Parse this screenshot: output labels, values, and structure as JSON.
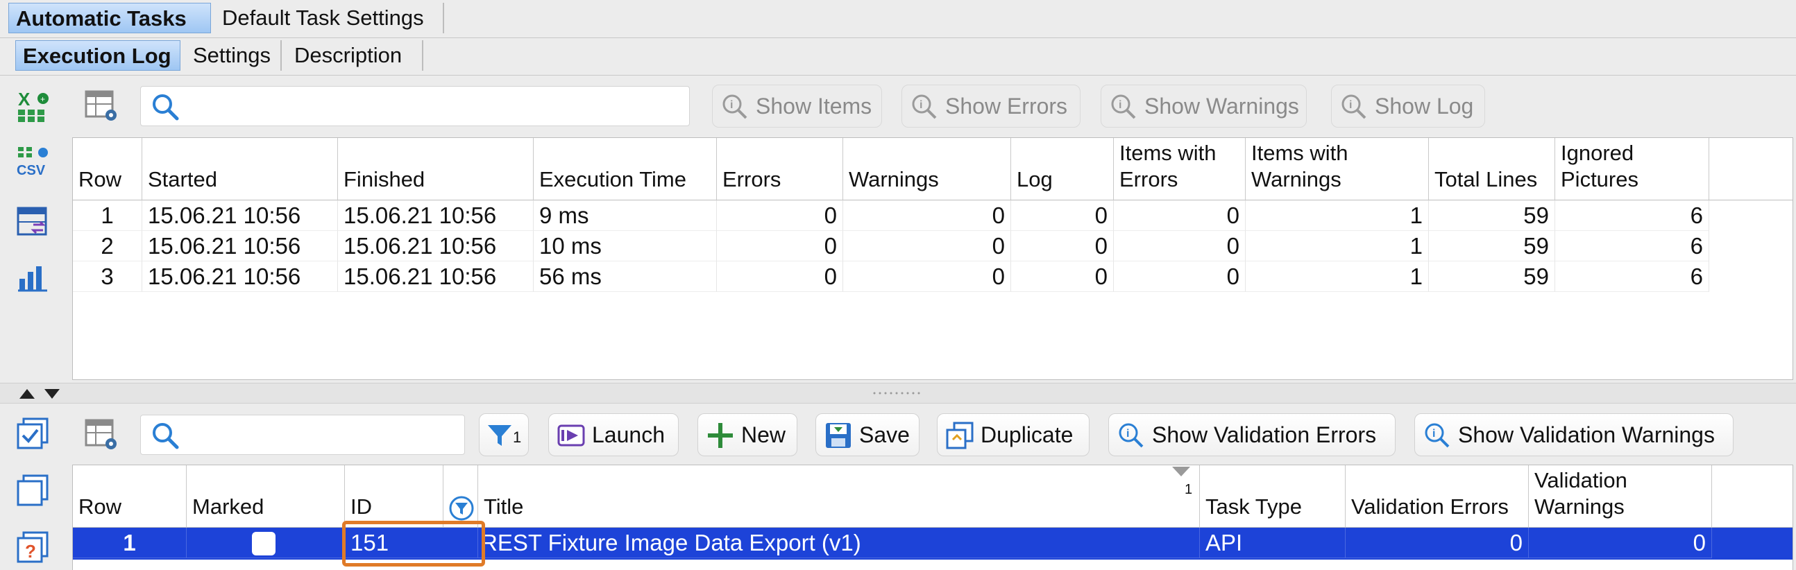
{
  "tabs_main": [
    {
      "label": "Automatic Tasks",
      "active": true
    },
    {
      "label": "Default Task Settings",
      "active": false
    }
  ],
  "tabs_sub": [
    {
      "label": "Execution Log",
      "active": true
    },
    {
      "label": "Settings",
      "active": false
    },
    {
      "label": "Description",
      "active": false
    }
  ],
  "log_toolbar": {
    "search_value": "",
    "buttons": [
      {
        "label": "Show Items",
        "enabled": false,
        "icon": "info-magnifier-icon"
      },
      {
        "label": "Show Errors",
        "enabled": false,
        "icon": "info-magnifier-icon"
      },
      {
        "label": "Show Warnings",
        "enabled": false,
        "icon": "info-magnifier-icon"
      },
      {
        "label": "Show Log",
        "enabled": false,
        "icon": "info-magnifier-icon"
      }
    ]
  },
  "sidebar_top": [
    {
      "icon": "excel-export-icon"
    },
    {
      "icon": "csv-export-icon"
    },
    {
      "icon": "table-swap-icon"
    },
    {
      "icon": "bar-chart-icon"
    }
  ],
  "log_table": {
    "columns": [
      {
        "label": "Row"
      },
      {
        "label": "Started"
      },
      {
        "label": "Finished"
      },
      {
        "label": "Execution Time"
      },
      {
        "label": "Errors"
      },
      {
        "label": "Warnings"
      },
      {
        "label": "Log"
      },
      {
        "label": "Items with Errors"
      },
      {
        "label": "Items with Warnings"
      },
      {
        "label": "Total Lines"
      },
      {
        "label": "Ignored Pictures"
      }
    ],
    "rows": [
      [
        "1",
        "15.06.21 10:56",
        "15.06.21 10:56",
        "9 ms",
        "0",
        "0",
        "0",
        "0",
        "1",
        "59",
        "6"
      ],
      [
        "2",
        "15.06.21 10:56",
        "15.06.21 10:56",
        "10 ms",
        "0",
        "0",
        "0",
        "0",
        "1",
        "59",
        "6"
      ],
      [
        "3",
        "15.06.21 10:56",
        "15.06.21 10:56",
        "56 ms",
        "0",
        "0",
        "0",
        "0",
        "1",
        "59",
        "6"
      ]
    ]
  },
  "tasks_toolbar": {
    "search_value": "",
    "filter_count": "1",
    "buttons": [
      {
        "label": "Launch",
        "icon": "launch-icon"
      },
      {
        "label": "New",
        "icon": "plus-icon"
      },
      {
        "label": "Save",
        "icon": "save-icon"
      },
      {
        "label": "Duplicate",
        "icon": "duplicate-icon"
      },
      {
        "label": "Show Validation Errors",
        "icon": "info-magnifier-icon"
      },
      {
        "label": "Show Validation Warnings",
        "icon": "info-magnifier-icon"
      }
    ]
  },
  "sidebar_bottom": [
    {
      "icon": "check-all-icon"
    },
    {
      "icon": "uncheck-all-icon"
    },
    {
      "icon": "help-copy-icon"
    }
  ],
  "task_table": {
    "columns": [
      {
        "label": "Row"
      },
      {
        "label": "Marked"
      },
      {
        "label": "ID"
      },
      {
        "label": ""
      },
      {
        "label": "Title"
      },
      {
        "label": "Task Type"
      },
      {
        "label": "Validation Errors"
      },
      {
        "label": "Validation Warnings"
      }
    ],
    "sort_indicator": "1",
    "rows": [
      {
        "row": "1",
        "marked": false,
        "id": "151",
        "title": "REST Fixture Image Data Export (v1)",
        "task_type": "API",
        "validation_errors": "0",
        "validation_warnings": "0",
        "selected": true
      }
    ]
  },
  "colors": {
    "selection": "#1d43d8",
    "highlight_outline": "#e07b28",
    "tab_active": "#a9cdf5"
  }
}
